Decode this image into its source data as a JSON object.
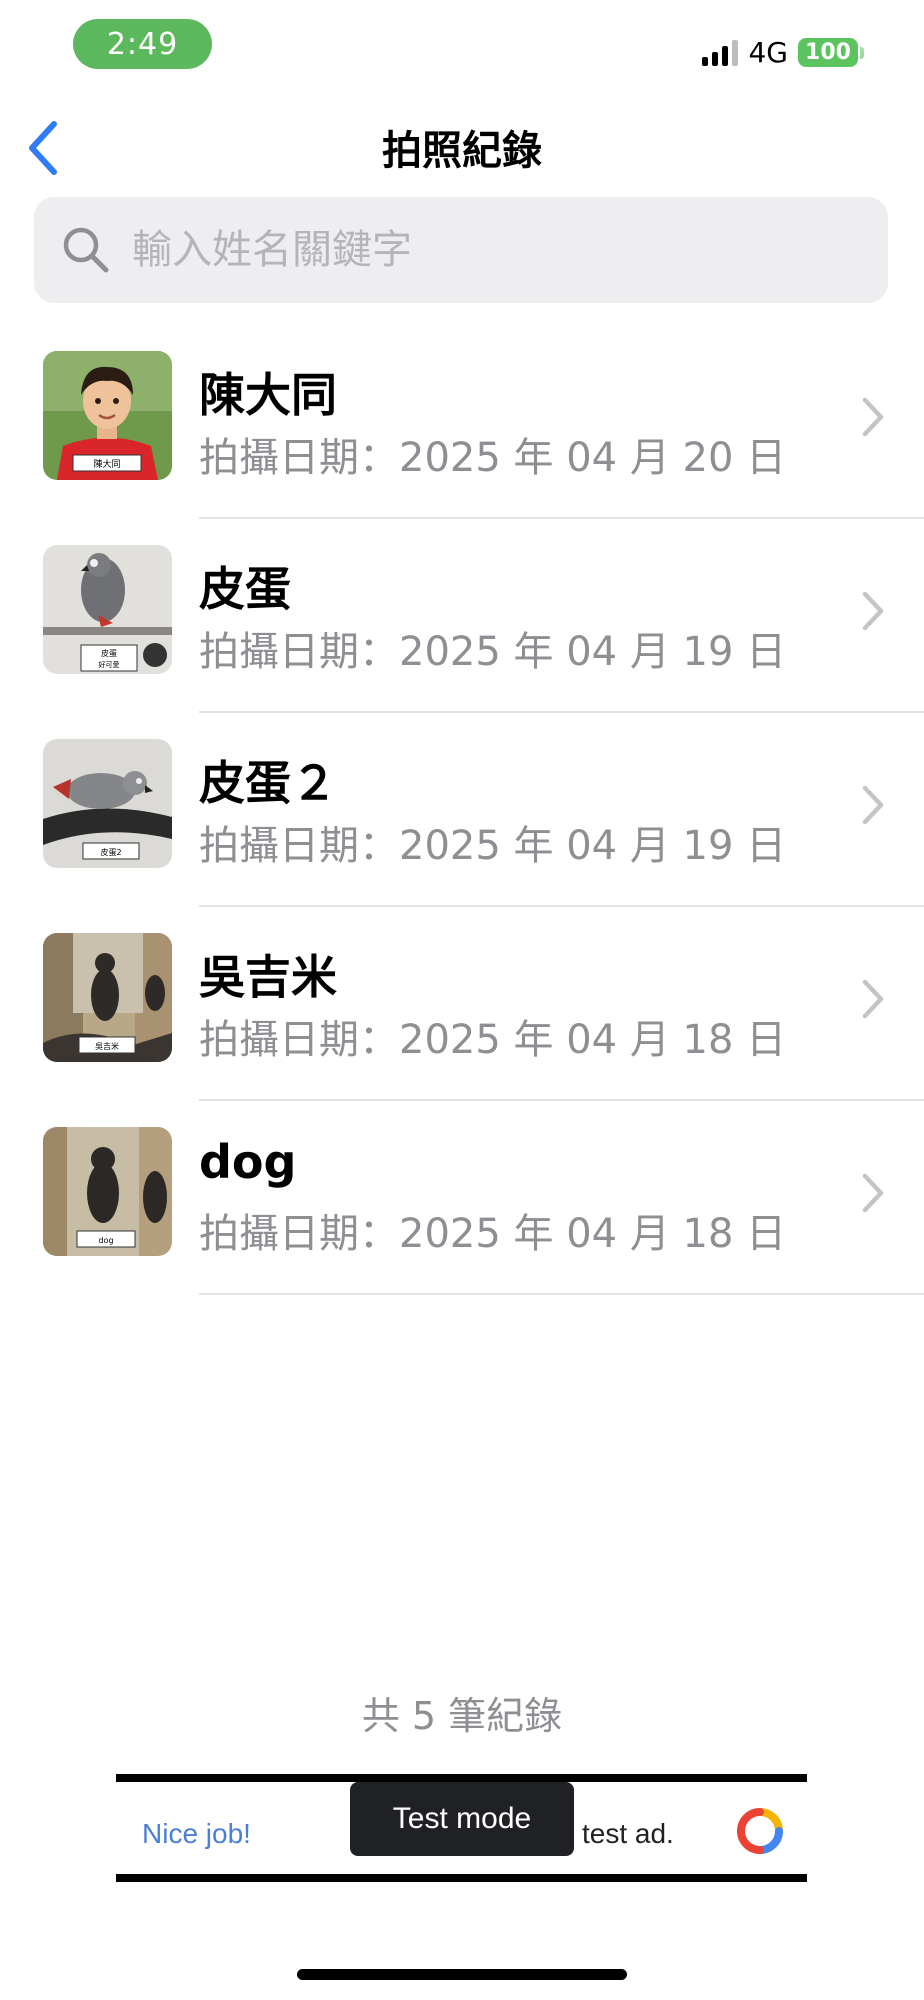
{
  "status_bar": {
    "time": "2:49",
    "network": "4G",
    "battery": "100"
  },
  "nav": {
    "title": "拍照紀錄"
  },
  "search": {
    "placeholder": "輸入姓名關鍵字"
  },
  "records": [
    {
      "name": "陳大同",
      "date": "拍攝日期：2025 年 04 月 20 日",
      "tag": "陳大同"
    },
    {
      "name": "皮蛋",
      "date": "拍攝日期：2025 年 04 月 19 日",
      "tag": "皮蛋",
      "tag2": "好可愛"
    },
    {
      "name": "皮蛋２",
      "date": "拍攝日期：2025 年 04 月 19 日",
      "tag": "皮蛋2"
    },
    {
      "name": "吳吉米",
      "date": "拍攝日期：2025 年 04 月 18 日",
      "tag": "吳吉米"
    },
    {
      "name": "dog",
      "date": "拍攝日期：2025 年 04 月 18 日",
      "tag": "dog"
    }
  ],
  "footer": {
    "count_text": "共 5 筆紀錄"
  },
  "ad": {
    "left_text": "Nice job!",
    "badge": "Test mode",
    "right_text": "test ad."
  },
  "colors": {
    "accent": "#2f7cf6",
    "status_green": "#5cb85c",
    "secondary_text": "#8e8e93"
  }
}
